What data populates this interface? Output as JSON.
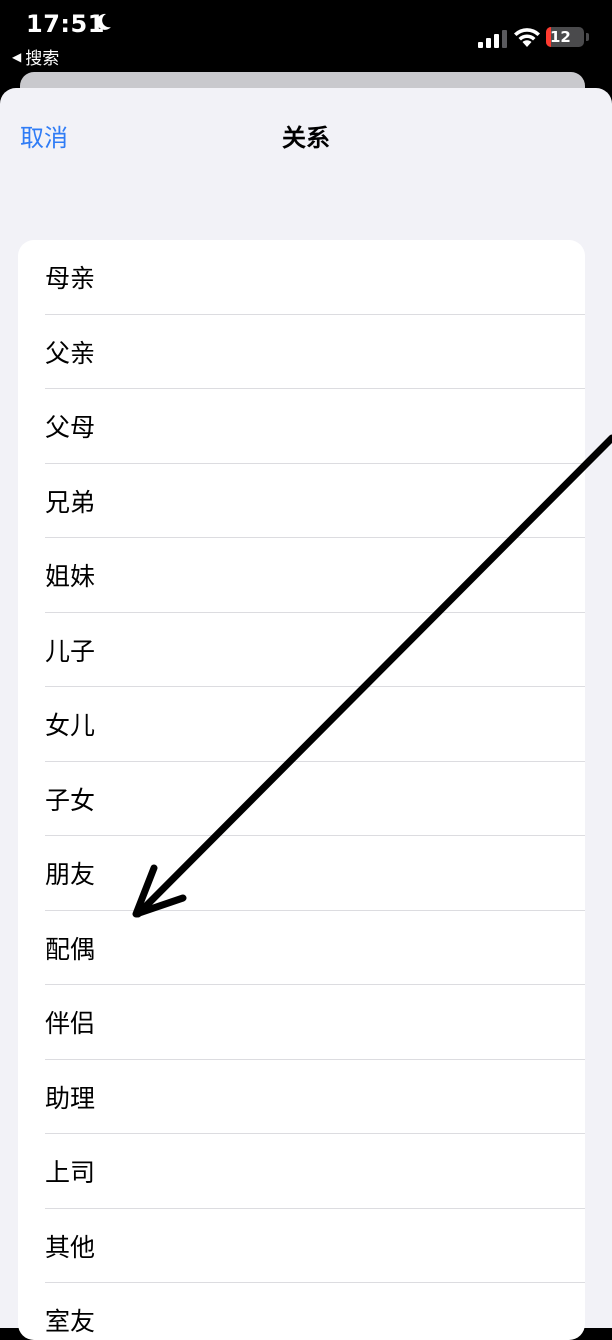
{
  "status_bar": {
    "time": "17:51",
    "back_app": "搜索",
    "battery": "12",
    "colors": {
      "battery_low": "#ff3b30"
    }
  },
  "header": {
    "cancel_label": "取消",
    "title": "关系"
  },
  "relationship_options": [
    "母亲",
    "父亲",
    "父母",
    "兄弟",
    "姐妹",
    "儿子",
    "女儿",
    "子女",
    "朋友",
    "配偶",
    "伴侣",
    "助理",
    "上司",
    "其他",
    "室友"
  ],
  "colors": {
    "accent": "#2f7cf6",
    "sheet_background": "#f2f2f7",
    "arrow": "#000000"
  }
}
